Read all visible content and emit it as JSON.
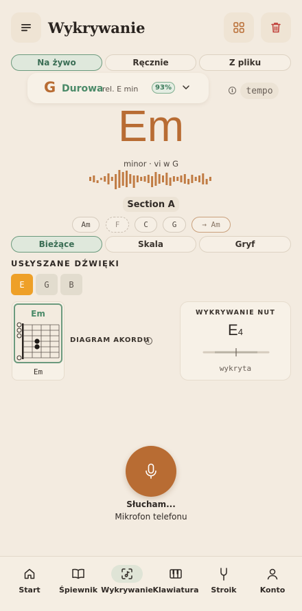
{
  "header": {
    "menu_icon": "hamburger-menu-icon",
    "title": "Wykrywanie",
    "grid_icon": "grid-icon",
    "trash_icon": "trash-icon"
  },
  "mode_tabs": [
    {
      "label": "Na żywo",
      "active": true
    },
    {
      "label": "Ręcznie",
      "active": false
    },
    {
      "label": "Z pliku",
      "active": false
    }
  ],
  "key": {
    "letter": "G",
    "mode": "Durowa",
    "relative": "rel. E min",
    "confidence": "93%"
  },
  "tempo_label": "tempo",
  "chord": {
    "name": "Em",
    "roman": "minor · vi w G"
  },
  "section_label": "Section A",
  "progression": [
    {
      "label": "Am",
      "style": "normal"
    },
    {
      "label": "F",
      "style": "dashed"
    },
    {
      "label": "C",
      "style": "normal"
    },
    {
      "label": "G",
      "style": "normal"
    },
    {
      "label": "→ Am",
      "style": "next"
    }
  ],
  "view_tabs": [
    {
      "label": "Bieżące",
      "active": true
    },
    {
      "label": "Skala",
      "active": false
    },
    {
      "label": "Gryf",
      "active": false
    }
  ],
  "heard_notes": {
    "title": "USŁYSZANE DŹWIĘKI",
    "notes": [
      {
        "label": "E",
        "active": true
      },
      {
        "label": "G",
        "active": false
      },
      {
        "label": "B",
        "active": false
      }
    ]
  },
  "chord_diagram": {
    "chord_top": "Em",
    "chord_bottom": "Em",
    "label": "DIAGRAM AKORDU"
  },
  "note_detection": {
    "title": "WYKRYWANIE NUT",
    "note": "E",
    "octave": "4",
    "status": "wykryta"
  },
  "listening": {
    "status": "Słucham...",
    "source": "Mikrofon telefonu"
  },
  "bottom_nav": [
    {
      "label": "Start",
      "icon": "home-icon",
      "active": false
    },
    {
      "label": "Śpiewnik",
      "icon": "book-icon",
      "active": false
    },
    {
      "label": "Wykrywanie",
      "icon": "detect-scan-icon",
      "active": true
    },
    {
      "label": "Klawiatura",
      "icon": "keyboard-icon",
      "active": false
    },
    {
      "label": "Stroik",
      "icon": "tuning-fork-icon",
      "active": false
    },
    {
      "label": "Konto",
      "icon": "user-icon",
      "active": false
    }
  ],
  "colors": {
    "background": "#f3ebe0",
    "accent": "#b86c33",
    "green": "#4a8a68",
    "note_active": "#eea028"
  }
}
